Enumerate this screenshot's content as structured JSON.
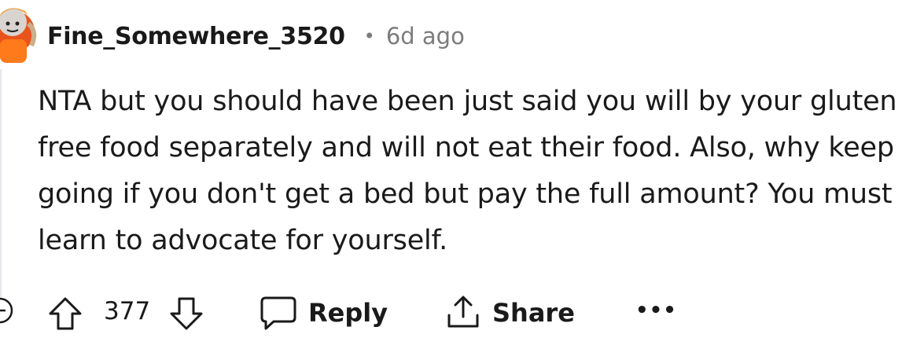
{
  "comment": {
    "username": "Fine_Somewhere_3520",
    "separator": "•",
    "timestamp": "6d ago",
    "body": "NTA but you should have been just said you will by your gluten free food separately and will not eat their food. Also, why keep going if you don't get a bed but pay the full amount? You must learn to advocate for yourself.",
    "score": "377"
  },
  "actions": {
    "reply_label": "Reply",
    "share_label": "Share",
    "more_label": "•••"
  },
  "icons": {
    "avatar": "avatar-icon",
    "collapse": "collapse-thread-icon",
    "upvote": "upvote-arrow-icon",
    "downvote": "downvote-arrow-icon",
    "reply": "speech-bubble-icon",
    "share": "share-upload-icon"
  },
  "colors": {
    "text": "#1a1a1b",
    "meta": "#7c7c7c",
    "avatar_orange": "#e8541c"
  }
}
